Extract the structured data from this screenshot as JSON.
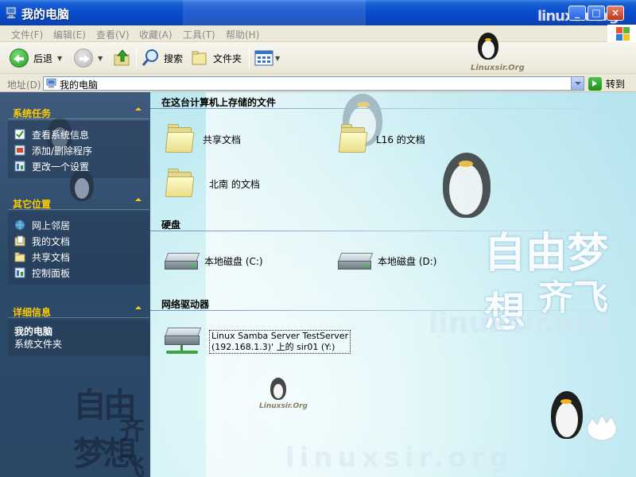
{
  "window": {
    "title": "我的电脑",
    "brand_logo": "linuxsir.org",
    "buttons": {
      "minimize": "_",
      "maximize": "□",
      "close": "×"
    }
  },
  "menubar": {
    "items": [
      "文件(F)",
      "编辑(E)",
      "查看(V)",
      "收藏(A)",
      "工具(T)",
      "帮助(H)"
    ]
  },
  "toolbar": {
    "back_label": "后退",
    "search_label": "搜索",
    "folders_label": "文件夹"
  },
  "address": {
    "label": "地址(D)",
    "value": "我的电脑",
    "go_label": "转到"
  },
  "sidebar": {
    "system_tasks": {
      "title": "系统任务",
      "items": [
        "查看系统信息",
        "添加/删除程序",
        "更改一个设置"
      ]
    },
    "other_places": {
      "title": "其它位置",
      "items": [
        "网上邻居",
        "我的文档",
        "共享文档",
        "控制面板"
      ]
    },
    "details": {
      "title": "详细信息",
      "name": "我的电脑",
      "type": "系统文件夹"
    }
  },
  "content": {
    "groups": [
      {
        "title": "在这台计算机上存储的文件",
        "items": [
          "共享文档",
          "L16 的文档",
          "北南 的文档"
        ]
      },
      {
        "title": "硬盘",
        "items": [
          "本地磁盘 (C:)",
          "本地磁盘 (D:)"
        ]
      },
      {
        "title": "网络驱动器",
        "items": [
          {
            "line1": "Linux Samba Server TestServer",
            "line2": "(192.168.1.3)' 上的 sir01 (Y:)"
          }
        ]
      }
    ]
  },
  "wallpaper": {
    "slogan_line1": "自由梦想",
    "slogan_line2": "齐飞",
    "logo_text": "Linuxsir.Org",
    "watermark": "linuxsir.org"
  }
}
